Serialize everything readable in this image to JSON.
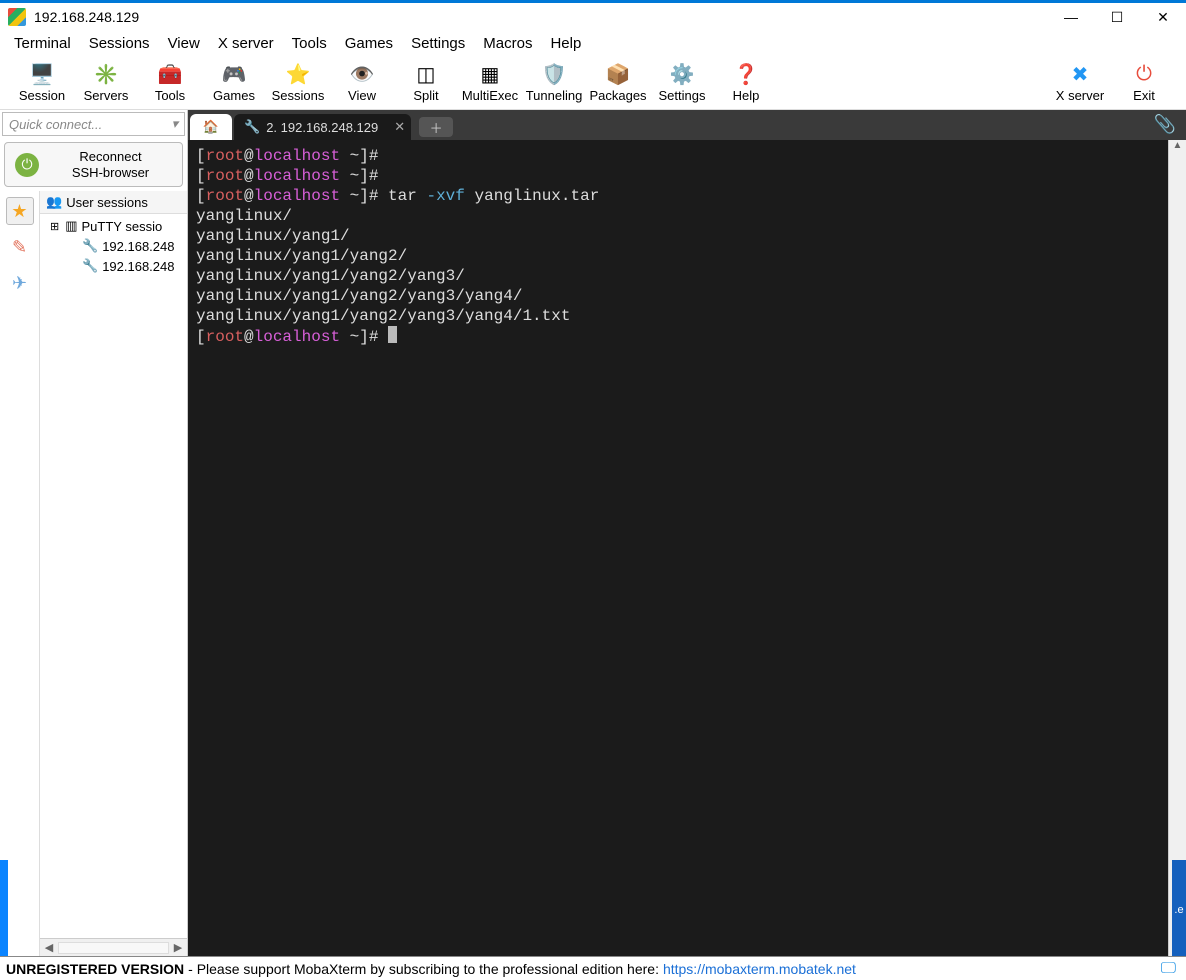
{
  "window": {
    "title": "192.168.248.129"
  },
  "menu": [
    "Terminal",
    "Sessions",
    "View",
    "X server",
    "Tools",
    "Games",
    "Settings",
    "Macros",
    "Help"
  ],
  "toolbar": [
    {
      "label": "Session",
      "icon": "🖥️"
    },
    {
      "label": "Servers",
      "icon": "✳️"
    },
    {
      "label": "Tools",
      "icon": "🧰"
    },
    {
      "label": "Games",
      "icon": "🎮"
    },
    {
      "label": "Sessions",
      "icon": "⭐"
    },
    {
      "label": "View",
      "icon": "👁️"
    },
    {
      "label": "Split",
      "icon": "◫"
    },
    {
      "label": "MultiExec",
      "icon": "▦"
    },
    {
      "label": "Tunneling",
      "icon": "🛡️"
    },
    {
      "label": "Packages",
      "icon": "📦"
    },
    {
      "label": "Settings",
      "icon": "⚙️"
    },
    {
      "label": "Help",
      "icon": "❓"
    }
  ],
  "toolbar_right": [
    {
      "label": "X server",
      "icon": "✖"
    },
    {
      "label": "Exit",
      "icon": "⏻"
    }
  ],
  "sidebar": {
    "quick_placeholder": "Quick connect...",
    "reconnect_line1": "Reconnect",
    "reconnect_line2": "SSH-browser",
    "tree_header": "User sessions",
    "items": [
      {
        "label": "PuTTY sessio",
        "icon": "▥"
      },
      {
        "label": "192.168.248",
        "icon": "🔧"
      },
      {
        "label": "192.168.248",
        "icon": "🔧"
      }
    ]
  },
  "tabs": {
    "active_label": "2. 192.168.248.129"
  },
  "terminal": {
    "lines": [
      {
        "type": "prompt",
        "cmd": ""
      },
      {
        "type": "prompt",
        "cmd": ""
      },
      {
        "type": "prompt",
        "cmd": "tar ",
        "opt": "-xvf ",
        "arg": "yanglinux.tar"
      },
      {
        "type": "out",
        "text": "yanglinux/"
      },
      {
        "type": "out",
        "text": "yanglinux/yang1/"
      },
      {
        "type": "out",
        "text": "yanglinux/yang1/yang2/"
      },
      {
        "type": "out",
        "text": "yanglinux/yang1/yang2/yang3/"
      },
      {
        "type": "out",
        "text": "yanglinux/yang1/yang2/yang3/yang4/"
      },
      {
        "type": "out",
        "text": "yanglinux/yang1/yang2/yang3/yang4/1.txt"
      },
      {
        "type": "prompt",
        "cursor": true
      }
    ],
    "user": "root",
    "host": "localhost",
    "path": "~"
  },
  "status": {
    "unreg": "UNREGISTERED VERSION",
    "msg": " -  Please support MobaXterm by subscribing to the professional edition here:  ",
    "link": "https://mobaxterm.mobatek.net"
  }
}
